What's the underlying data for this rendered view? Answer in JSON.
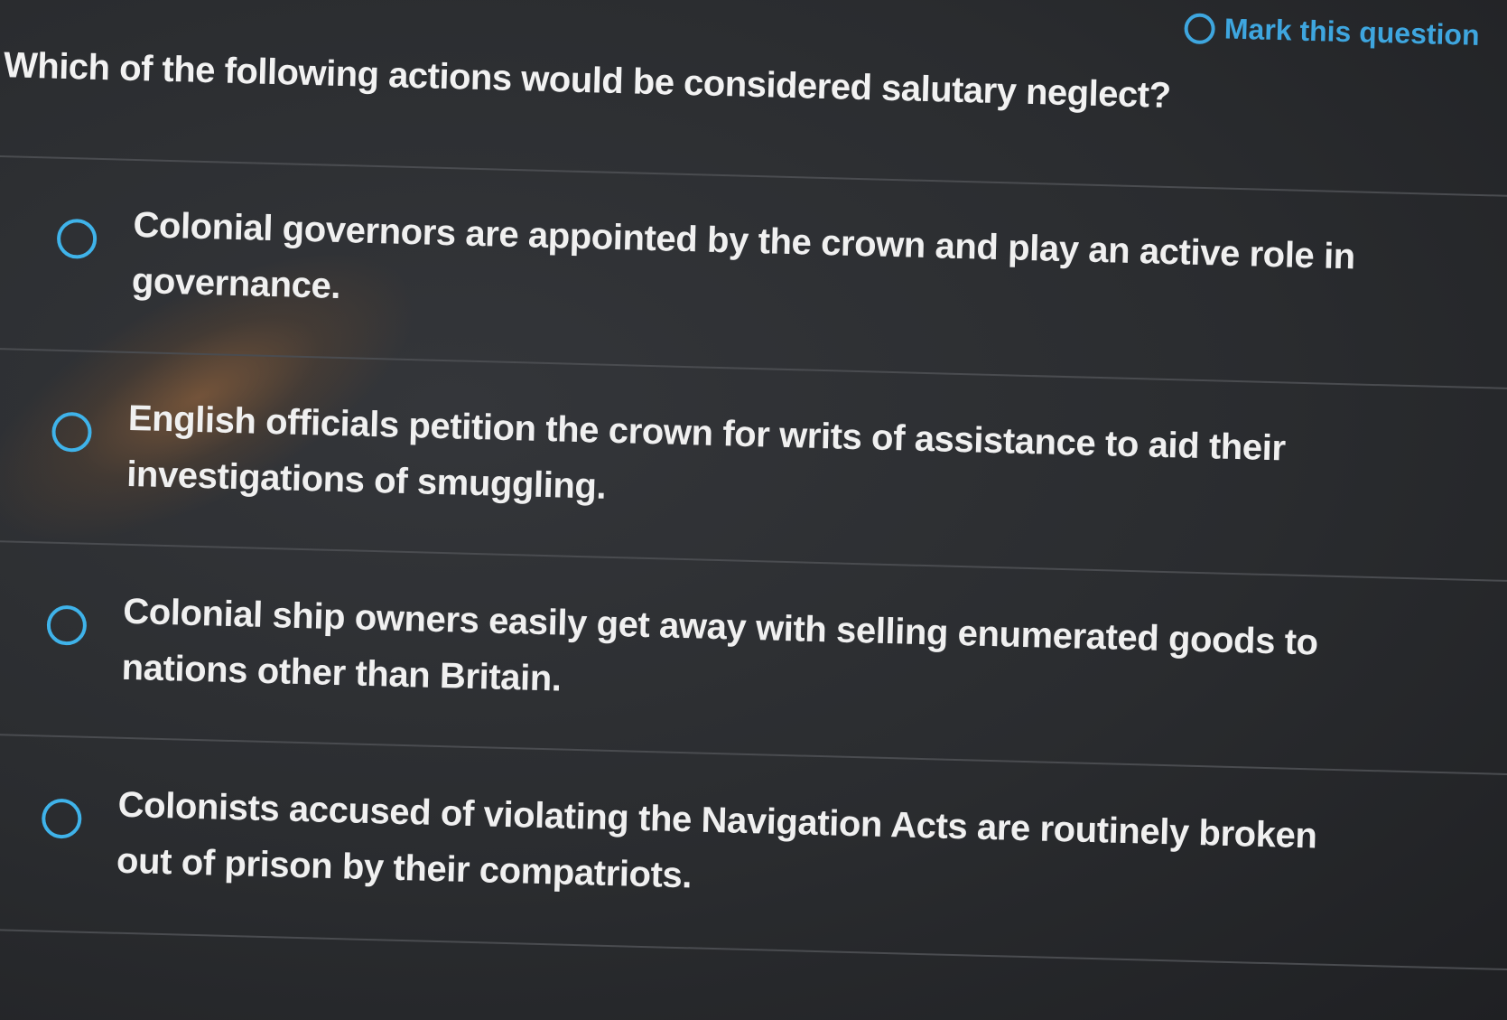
{
  "header": {
    "mark_label": "Mark this question"
  },
  "question": {
    "text": "Which of the following actions would be considered salutary neglect?"
  },
  "options": [
    {
      "label": "Colonial governors are appointed by the crown and play an active role in governance."
    },
    {
      "label": "English officials petition the crown for writs of assistance to aid their investigations of smuggling."
    },
    {
      "label": "Colonial ship owners easily get away with selling enumerated goods to nations other than Britain."
    },
    {
      "label": "Colonists accused of violating the Navigation Acts are routinely broken out of prison by their compatriots."
    }
  ],
  "colors": {
    "accent": "#3fb3ea",
    "background": "#2b2d30",
    "text": "#f0f0f0"
  }
}
